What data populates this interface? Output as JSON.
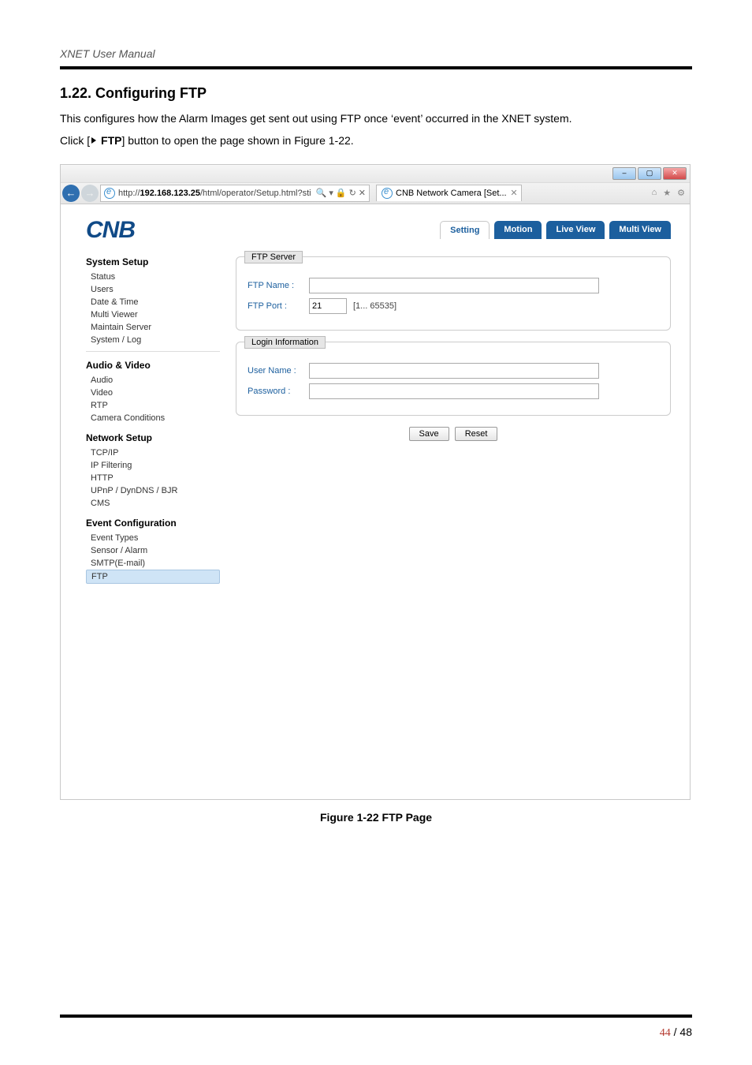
{
  "doc": {
    "running_head": "XNET User Manual",
    "section_title": "1.22. Configuring FTP",
    "intro_text": "This configures how the Alarm Images get sent out using FTP once ‘event’ occurred in the XNET system.",
    "click_prefix": "Click [",
    "click_label": "FTP",
    "click_suffix": "] button to open the page shown in Figure 1-22.",
    "figure_caption": "Figure 1-22 FTP Page",
    "page_current": "44",
    "page_sep": " / ",
    "page_total": "48"
  },
  "window": {
    "min": "–",
    "max": "▢",
    "close": "✕",
    "back": "←",
    "fwd": "→",
    "url_prefix": "http://",
    "url_host": "192.168.123.25",
    "url_path": "/html/operator/Setup.html?sti",
    "search_icon": "🔍",
    "dropdown": "▾",
    "lock_icon": "🔒",
    "refresh": "↻",
    "stop": "✕",
    "tab_title": "CNB Network Camera [Set...",
    "tab_close": "✕",
    "tool_home": "⌂",
    "tool_fav": "★",
    "tool_gear": "⚙"
  },
  "cnb": {
    "logo": "CNB",
    "tabs": {
      "setting": "Setting",
      "motion": "Motion",
      "live": "Live View",
      "multi": "Multi View"
    },
    "sidebar": {
      "system_setup": "System Setup",
      "status": "Status",
      "users": "Users",
      "datetime": "Date & Time",
      "multiviewer": "Multi Viewer",
      "maintain": "Maintain Server",
      "syslog": "System / Log",
      "audio_video": "Audio & Video",
      "audio": "Audio",
      "video": "Video",
      "rtp": "RTP",
      "camcond": "Camera Conditions",
      "network_setup": "Network Setup",
      "tcpip": "TCP/IP",
      "ipfilter": "IP Filtering",
      "http": "HTTP",
      "upnp": "UPnP / DynDNS / BJR",
      "cms": "CMS",
      "event_conf": "Event Configuration",
      "event_types": "Event Types",
      "sensor": "Sensor / Alarm",
      "smtp": "SMTP(E-mail)",
      "ftp": "FTP"
    },
    "form": {
      "ftp_server_legend": "FTP Server",
      "ftp_name_label": "FTP Name :",
      "ftp_name_value": "",
      "ftp_port_label": "FTP Port :",
      "ftp_port_value": "21",
      "ftp_port_hint": "[1... 65535]",
      "login_legend": "Login Information",
      "user_label": "User Name :",
      "user_value": "",
      "pass_label": "Password :",
      "pass_value": "",
      "save": "Save",
      "reset": "Reset"
    }
  }
}
